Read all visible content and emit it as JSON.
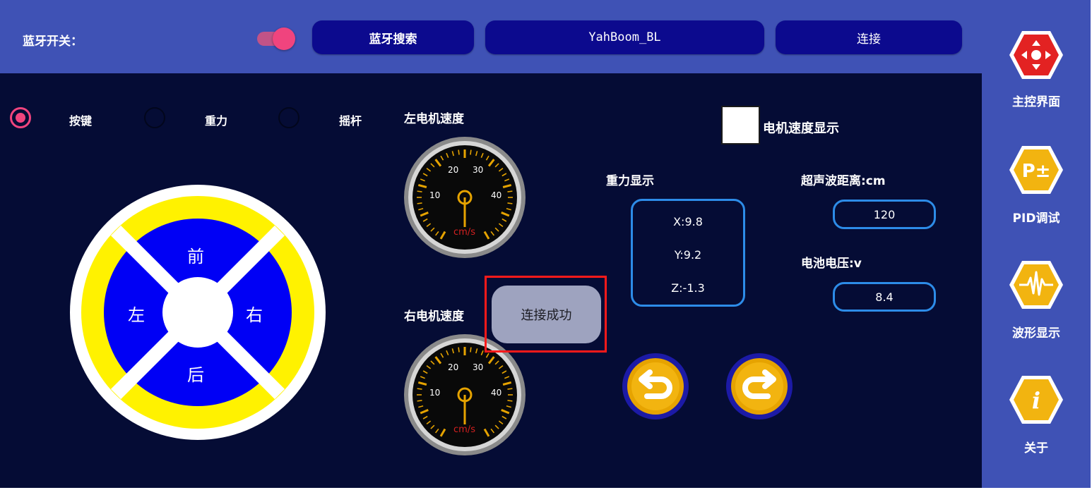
{
  "top": {
    "bluetooth_switch_label": "蓝牙开关：",
    "search_button": "蓝牙搜索",
    "device_name": "YahBoom_BL",
    "connect_button": "连接"
  },
  "mode": {
    "options": [
      "按键",
      "重力",
      "摇杆"
    ],
    "selected": "按键"
  },
  "direction_pad": {
    "forward": "前",
    "back": "后",
    "left": "左",
    "right": "右"
  },
  "gauges": {
    "left_title": "左电机速度",
    "right_title": "右电机速度",
    "tick_labels": [
      "10",
      "20",
      "30",
      "40"
    ],
    "unit": "cm/s"
  },
  "toast": {
    "message": "连接成功"
  },
  "motor_speed_checkbox_label": "电机速度显示",
  "gravity": {
    "title": "重力显示",
    "x": "X:9.8",
    "y": "Y:9.2",
    "z": "Z:-1.3"
  },
  "ultrasonic": {
    "label": "超声波距离:cm",
    "value": "120"
  },
  "battery": {
    "label": "电池电压:v",
    "value": "8.4"
  },
  "sidebar": {
    "items": [
      {
        "label": "主控界面",
        "icon": "dpad-icon"
      },
      {
        "label": "PID调试",
        "icon": "pid-icon"
      },
      {
        "label": "波形显示",
        "icon": "waveform-icon"
      },
      {
        "label": "关于",
        "icon": "info-icon"
      }
    ]
  },
  "colors": {
    "header_blue": "#3f52b5",
    "panel_navy": "#050c35",
    "button_navy": "#0c0a8e",
    "accent_pink": "#f0447e",
    "pad_yellow": "#fff200",
    "pad_blue": "#0000f5",
    "readout_border": "#2d8ce8",
    "gold": "#e6a300",
    "sidebar_red": "#e32222"
  }
}
